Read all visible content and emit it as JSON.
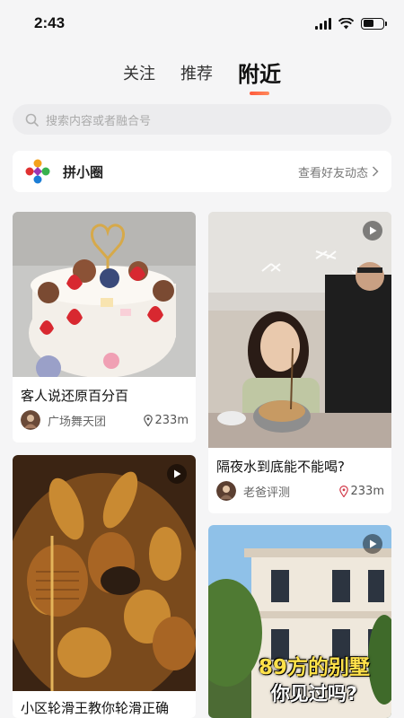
{
  "status": {
    "time": "2:43"
  },
  "tabs": [
    {
      "label": "关注"
    },
    {
      "label": "推荐"
    },
    {
      "label": "附近"
    }
  ],
  "search": {
    "placeholder": "搜索内容或者融合号"
  },
  "circle": {
    "title": "拼小圈",
    "link_label": "查看好友动态"
  },
  "feed": [
    {
      "title": "客人说还原百分百",
      "author": "广场舞天团",
      "distance": "233m",
      "video": false
    },
    {
      "title": "隔夜水到底能不能喝?",
      "author": "老爸评测",
      "distance": "233m",
      "video": true
    },
    {
      "title": "小区轮滑王教你轮滑正确",
      "author": "",
      "distance": "",
      "video": true
    },
    {
      "title": "",
      "overlay_text": [
        "89方的别墅",
        "你见过吗?"
      ],
      "author": "",
      "distance": "",
      "video": true
    }
  ],
  "colors": {
    "accent": "#ff5a3c",
    "background": "#f5f5f6"
  }
}
